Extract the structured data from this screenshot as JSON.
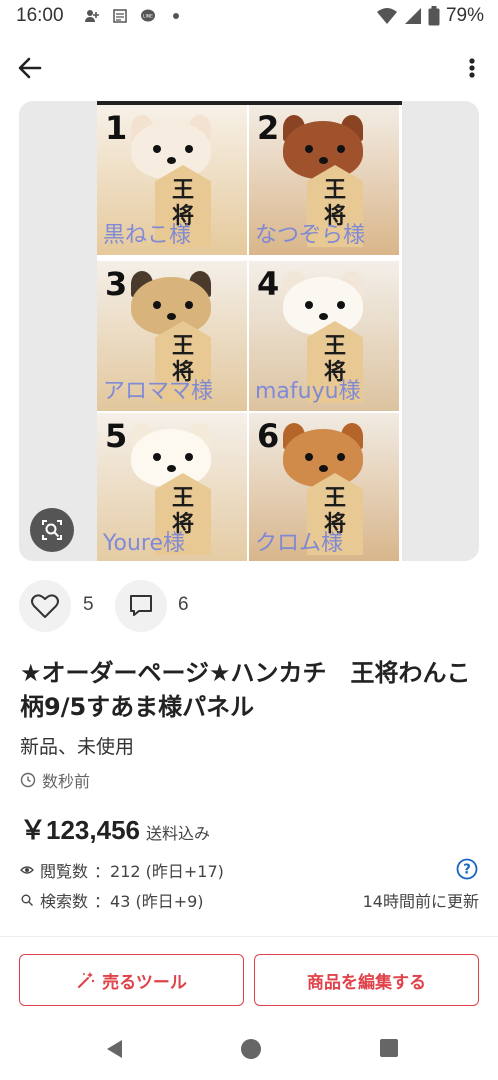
{
  "status_bar": {
    "time": "16:00",
    "battery": "79%",
    "icons": [
      "person-add-icon",
      "news-icon",
      "line-icon",
      "dot-icon",
      "wifi-icon",
      "signal-icon",
      "battery-icon"
    ]
  },
  "image": {
    "cells": [
      {
        "num": "1",
        "watermark": "黒ねこ様",
        "kanji": "王将"
      },
      {
        "num": "2",
        "watermark": "なつぞら様",
        "kanji": "王将"
      },
      {
        "num": "3",
        "watermark": "アロママ様",
        "kanji": "王将"
      },
      {
        "num": "4",
        "watermark": "mafuyu様",
        "kanji": "王将"
      },
      {
        "num": "5",
        "watermark": "Youre様",
        "kanji": "王将"
      },
      {
        "num": "6",
        "watermark": "クロム様",
        "kanji": "王将"
      }
    ]
  },
  "social": {
    "likes": "5",
    "comments": "6"
  },
  "item": {
    "title": "★オーダーページ★ハンカチ　王将わんこ柄9/5すあま様パネル",
    "condition": "新品、未使用",
    "time": "数秒前",
    "price": "￥123,456",
    "shipping": "送料込み"
  },
  "stats": {
    "views_label": "閲覧数",
    "views_value": "：212 (昨日+17)",
    "search_label": "検索数",
    "search_value": "：43 (昨日+9)",
    "updated": "14時間前に更新"
  },
  "actions": {
    "sell_tools": "売るツール",
    "edit": "商品を編集する"
  },
  "colors": {
    "accent": "#e0424a",
    "watermark": "#6f7fe0",
    "help": "#1565c0"
  }
}
